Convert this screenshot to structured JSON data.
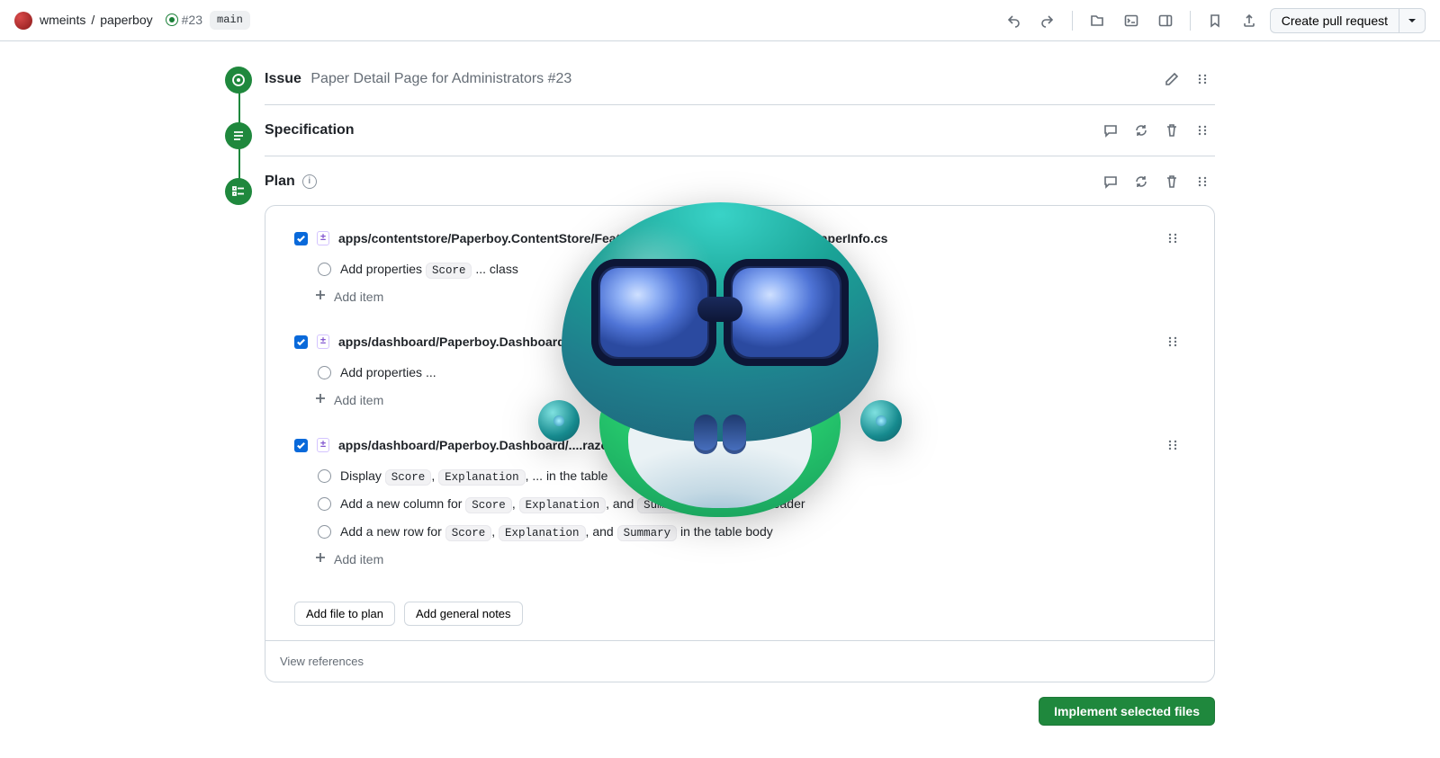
{
  "toolbar": {
    "owner": "wmeints",
    "sep": "/",
    "repo": "paperboy",
    "issue_ref": "#23",
    "branch": "main",
    "create_pr": "Create pull request"
  },
  "sections": {
    "issue": {
      "label": "Issue",
      "title": "Paper Detail Page for Administrators #23"
    },
    "spec": {
      "label": "Specification"
    },
    "plan": {
      "label": "Plan"
    }
  },
  "plan": {
    "files": [
      {
        "path": "apps/contentstore/Paperboy.ContentStore/Features/QueryPapers/Notifications/PaperInfo.cs",
        "tasks": [
          {
            "prefix": "Add properties ",
            "code1": "Score",
            "suffix": " ... class"
          }
        ]
      },
      {
        "path": "apps/dashboard/Paperboy.Dashboard/...cs",
        "tasks": [
          {
            "prefix": "Add properties ...",
            "code1": "",
            "suffix": ""
          }
        ]
      },
      {
        "path": "apps/dashboard/Paperboy.Dashboard/....razor",
        "tasks": [
          {
            "prefix": "Display ",
            "code1": "Score",
            "mid1": ", ",
            "code2": "Explanation",
            "mid2": ", ... in the table",
            "suffix": ""
          },
          {
            "prefix": "Add a new column for ",
            "code1": "Score",
            "mid1": ", ",
            "code2": "Explanation",
            "mid2": ", and ",
            "code3": "Summary",
            "suffix": " in the table header"
          },
          {
            "prefix": "Add a new row for ",
            "code1": "Score",
            "mid1": ", ",
            "code2": "Explanation",
            "mid2": ", and ",
            "code3": "Summary",
            "suffix": " in the table body"
          }
        ]
      }
    ],
    "add_item": "Add item",
    "add_file": "Add file to plan",
    "add_notes": "Add general notes",
    "view_refs": "View references",
    "implement": "Implement selected files"
  }
}
